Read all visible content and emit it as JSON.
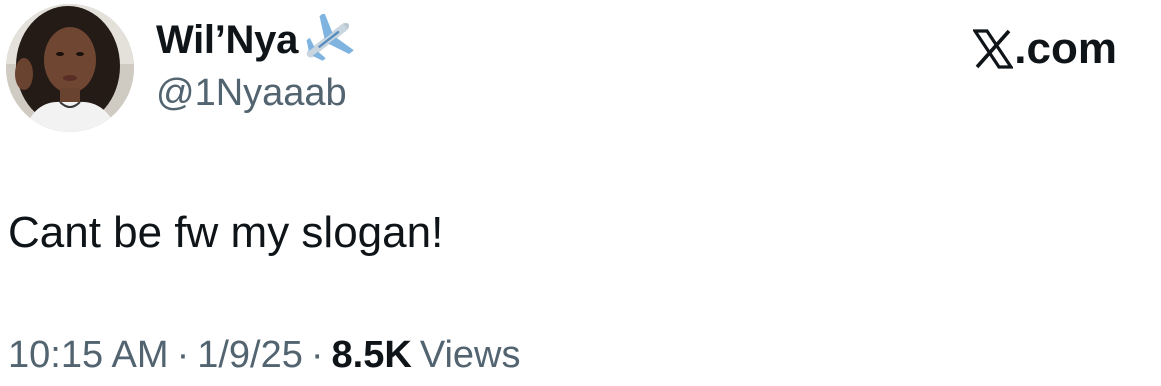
{
  "author": {
    "display_name": "Wil’Nya",
    "name_emoji": "airplane-icon",
    "handle": "@1Nyaaab",
    "avatar_alt": "profile photo"
  },
  "brand": {
    "label": ".com",
    "icon": "x-logo-icon"
  },
  "tweet": {
    "text": "Cant be fw my slogan!"
  },
  "meta": {
    "time": "10:15 AM",
    "separator": "·",
    "date": "1/9/25",
    "views_count": "8.5K",
    "views_label": "Views"
  },
  "colors": {
    "text_primary": "#0f1419",
    "text_secondary": "#536471",
    "background": "#ffffff"
  }
}
